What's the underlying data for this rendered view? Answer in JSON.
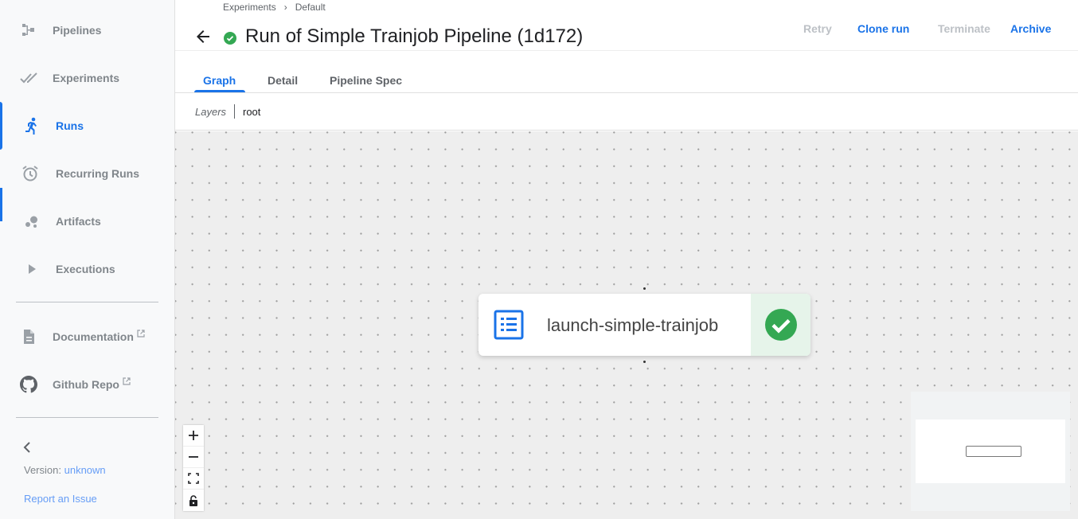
{
  "sidebar": {
    "items": [
      {
        "label": "Pipelines",
        "icon": "pipelines-icon"
      },
      {
        "label": "Experiments",
        "icon": "experiments-icon"
      },
      {
        "label": "Runs",
        "icon": "runs-icon",
        "active": true
      },
      {
        "label": "Recurring Runs",
        "icon": "alarm-clock-icon"
      },
      {
        "label": "Artifacts",
        "icon": "bubble-chart-icon"
      },
      {
        "label": "Executions",
        "icon": "play-arrow-icon"
      }
    ],
    "links": [
      {
        "label": "Documentation",
        "icon": "description-icon"
      },
      {
        "label": "Github Repo",
        "icon": "github-icon"
      }
    ],
    "version_label": "Version:",
    "version_value": "unknown",
    "report_issue": "Report an Issue"
  },
  "header": {
    "breadcrumb": [
      "Experiments",
      "Default"
    ],
    "breadcrumb_separator": "›",
    "title": "Run of Simple Trainjob Pipeline (1d172)",
    "actions": {
      "retry": "Retry",
      "clone_run": "Clone run",
      "terminate": "Terminate",
      "archive": "Archive"
    }
  },
  "tabs": [
    "Graph",
    "Detail",
    "Pipeline Spec"
  ],
  "layers": {
    "label": "Layers",
    "root": "root"
  },
  "graph": {
    "node_label": "launch-simple-trainjob",
    "node_status": "succeeded"
  },
  "colors": {
    "accent": "#1a73e8",
    "success": "#34a853",
    "disabled": "#bdc1c6"
  }
}
